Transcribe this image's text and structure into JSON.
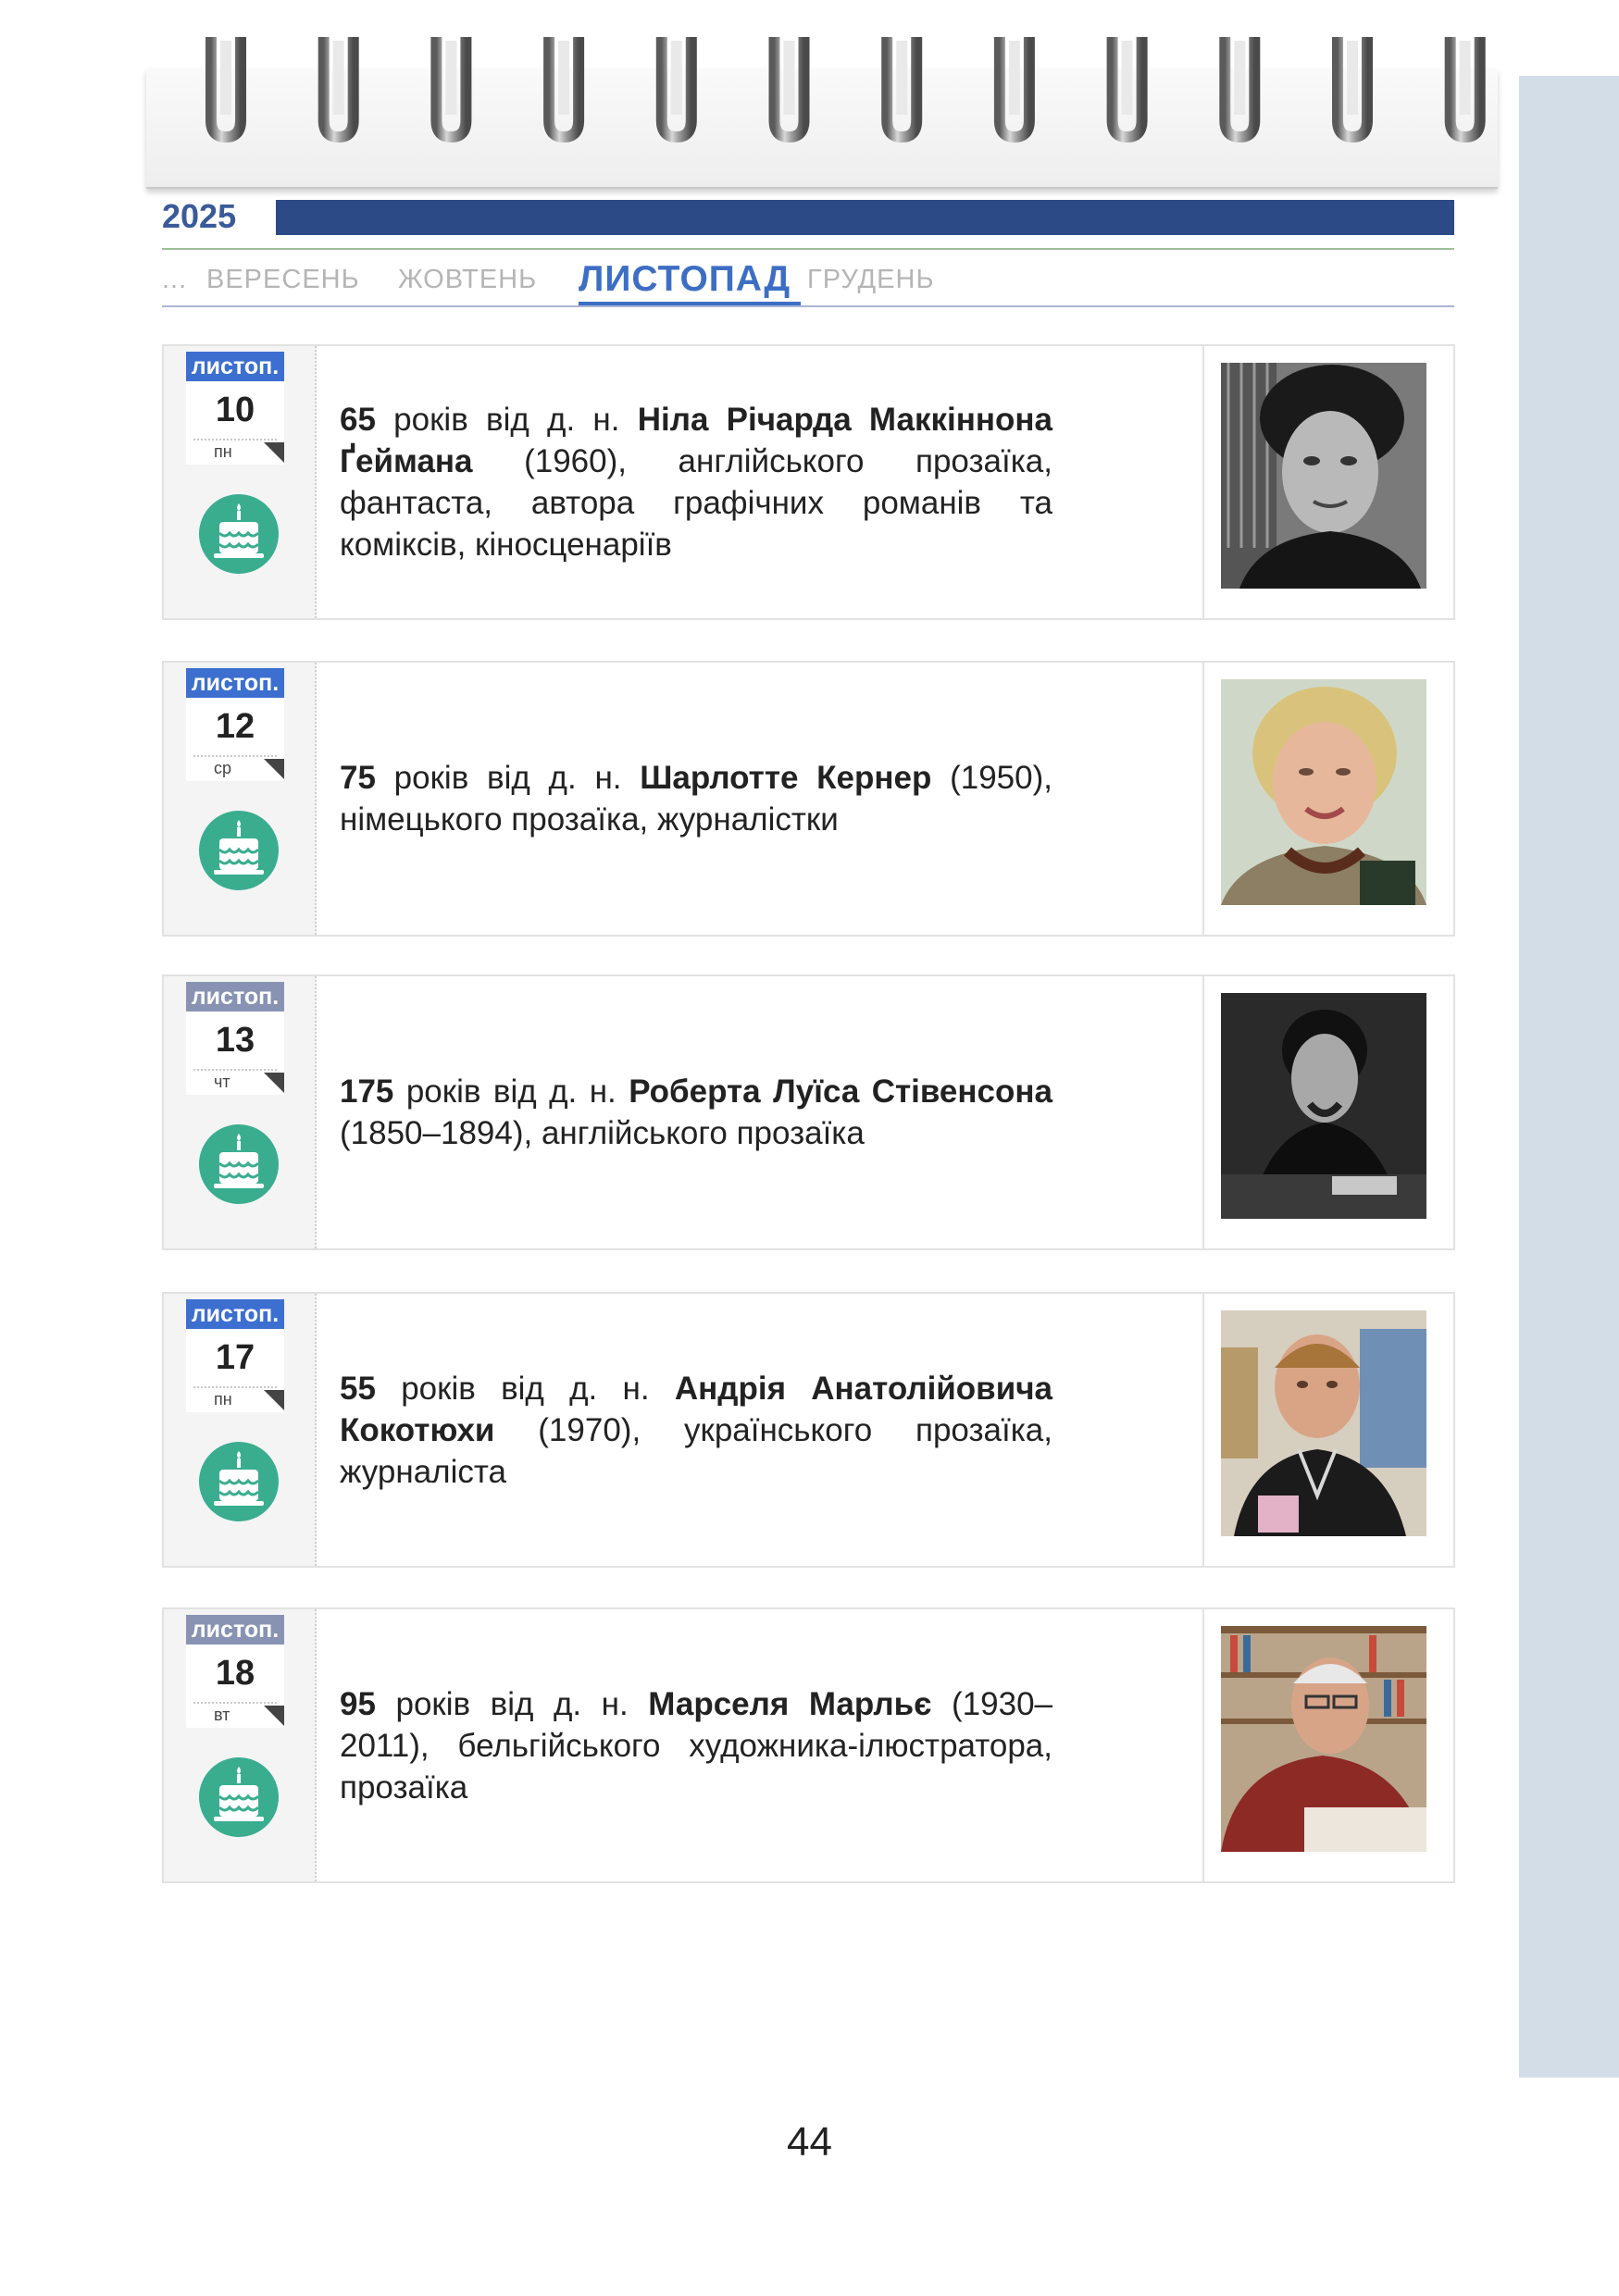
{
  "year": "2025",
  "months": {
    "ellipsis": "...",
    "items": [
      "ВЕРЕСЕНЬ",
      "ЖОВТЕНЬ",
      "ЛИСТОПАД",
      "ГРУДЕНЬ"
    ],
    "active_index": 2
  },
  "events": [
    {
      "month_tab": "листоп.",
      "day": "10",
      "weekday": "пн",
      "years": "65",
      "pre": " років від д. н. ",
      "name": "Ніла Річарда Маккіннона Ґеймана",
      "post": " (1960), англійського прозаїка, фантаста, автора графічних романів та коміксів, кіносценаріїв",
      "photo": "portrait-bw-man-curly-hair"
    },
    {
      "month_tab": "листоп.",
      "day": "12",
      "weekday": "ср",
      "years": "75",
      "pre": " років від д. н. ",
      "name": "Шарлотте Кернер",
      "post": " (1950), німецького прозаїка, журналістки",
      "photo": "portrait-color-woman-blonde"
    },
    {
      "month_tab": "листоп.",
      "day": "13",
      "weekday": "чт",
      "years": "175",
      "pre": " років від д. н. ",
      "name": "Роберта Луїса Стівенсона",
      "post": " (1850–1894), англійського прозаїка",
      "photo": "portrait-bw-man-writing"
    },
    {
      "month_tab": "листоп.",
      "day": "17",
      "weekday": "пн",
      "years": "55",
      "pre": " років від д. н. ",
      "name": "Андрія Анатолійовича Кокотюхи",
      "post": " (1970), українського прозаїка, журналіста",
      "photo": "portrait-color-man-bookstore"
    },
    {
      "month_tab": "листоп.",
      "day": "18",
      "weekday": "вт",
      "years": "95",
      "pre": " років від д. н. ",
      "name": "Марселя Марльє",
      "post": " (1930–2011), бельгійського художника-ілюстратора, прозаїка",
      "photo": "portrait-color-old-man-drawing"
    }
  ],
  "page_number": "44"
}
